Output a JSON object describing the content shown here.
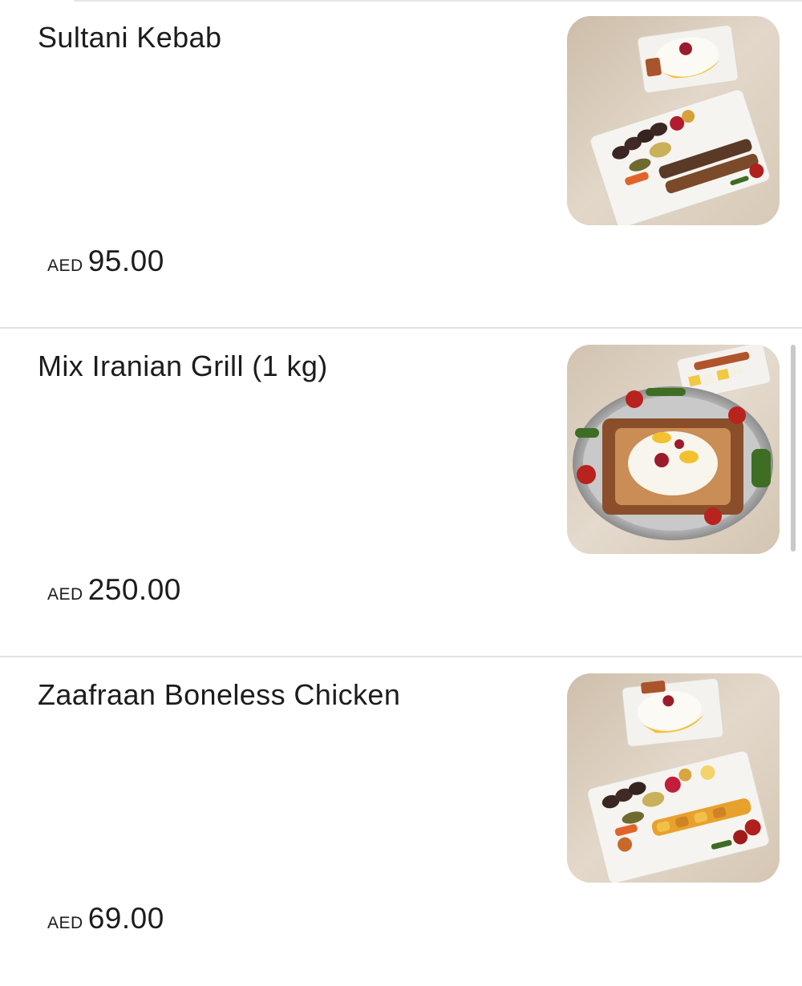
{
  "menu": {
    "items": [
      {
        "name": "Sultani Kebab",
        "currency": "AED",
        "price": "95.00",
        "image_icon": "kebab-platter-image"
      },
      {
        "name": "Mix Iranian Grill (1 kg)",
        "currency": "AED",
        "price": "250.00",
        "image_icon": "mixed-grill-platter-image"
      },
      {
        "name": "Zaafraan Boneless Chicken",
        "currency": "AED",
        "price": "69.00",
        "image_icon": "chicken-kebab-platter-image"
      }
    ]
  },
  "colors": {
    "background": "#ffffff",
    "text": "#1c1c1e",
    "divider": "#e2e2e2",
    "image_backdrop": "#d9ccbc"
  }
}
